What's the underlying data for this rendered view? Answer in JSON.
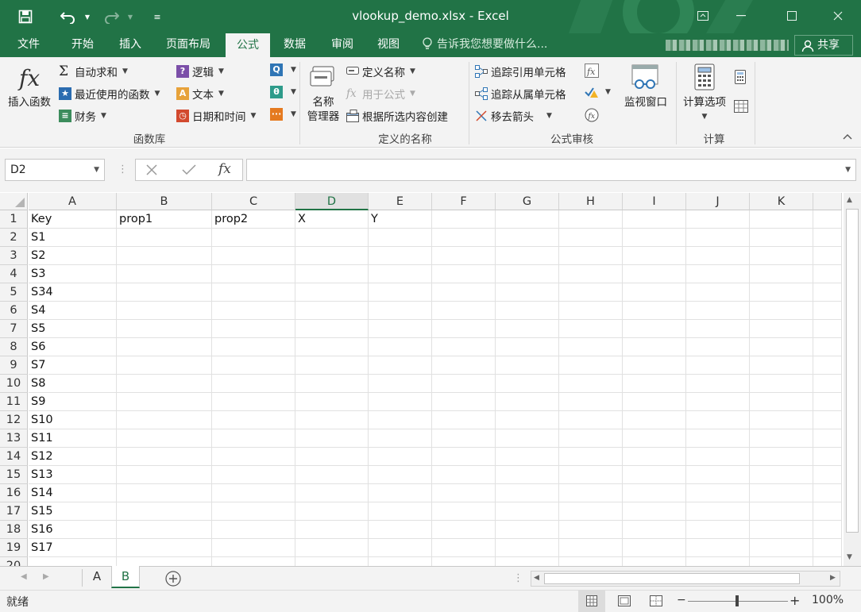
{
  "window": {
    "title": "vlookup_demo.xlsx - Excel"
  },
  "quick_access": {
    "icons": [
      "save-icon",
      "undo-icon",
      "redo-icon",
      "customize-icon"
    ]
  },
  "tabs": [
    {
      "label": "文件"
    },
    {
      "label": "开始"
    },
    {
      "label": "插入"
    },
    {
      "label": "页面布局"
    },
    {
      "label": "公式",
      "active": true
    },
    {
      "label": "数据"
    },
    {
      "label": "审阅"
    },
    {
      "label": "视图"
    }
  ],
  "tell_me": "告诉我您想要做什么...",
  "share": "共享",
  "ribbon": {
    "function_library": {
      "insert_function": "插入函数",
      "autosum": "自动求和",
      "recently_used": "最近使用的函数",
      "financial": "财务",
      "logical": "逻辑",
      "text": "文本",
      "date_time": "日期和时间",
      "group_label": "函数库"
    },
    "defined_names": {
      "name_manager_line1": "名称",
      "name_manager_line2": "管理器",
      "define_name": "定义名称",
      "use_in_formula": "用于公式",
      "create_from_selection": "根据所选内容创建",
      "group_label": "定义的名称"
    },
    "formula_auditing": {
      "trace_precedents": "追踪引用单元格",
      "trace_dependents": "追踪从属单元格",
      "remove_arrows": "移去箭头",
      "watch_window": "监视窗口",
      "group_label": "公式审核"
    },
    "calculation": {
      "calc_options": "计算选项",
      "group_label": "计算"
    }
  },
  "formula_bar": {
    "name_box": "D2",
    "formula": ""
  },
  "sheet": {
    "columns": [
      "A",
      "B",
      "C",
      "D",
      "E",
      "F",
      "G",
      "H",
      "I",
      "J",
      "K"
    ],
    "selected_column": "D",
    "rows": [
      [
        "Key",
        "prop1",
        "prop2",
        "X",
        "Y"
      ],
      [
        "S1"
      ],
      [
        "S2"
      ],
      [
        "S3"
      ],
      [
        "S34"
      ],
      [
        "S4"
      ],
      [
        "S5"
      ],
      [
        "S6"
      ],
      [
        "S7"
      ],
      [
        "S8"
      ],
      [
        "S9"
      ],
      [
        "S10"
      ],
      [
        "S11"
      ],
      [
        "S12"
      ],
      [
        "S13"
      ],
      [
        "S14"
      ],
      [
        "S15"
      ],
      [
        "S16"
      ],
      [
        "S17"
      ],
      [
        ""
      ]
    ]
  },
  "sheet_tabs": [
    {
      "label": "A"
    },
    {
      "label": "B",
      "active": true
    }
  ],
  "status": {
    "ready": "就绪",
    "zoom": "100%"
  },
  "colors": {
    "excel_green": "#217346"
  }
}
